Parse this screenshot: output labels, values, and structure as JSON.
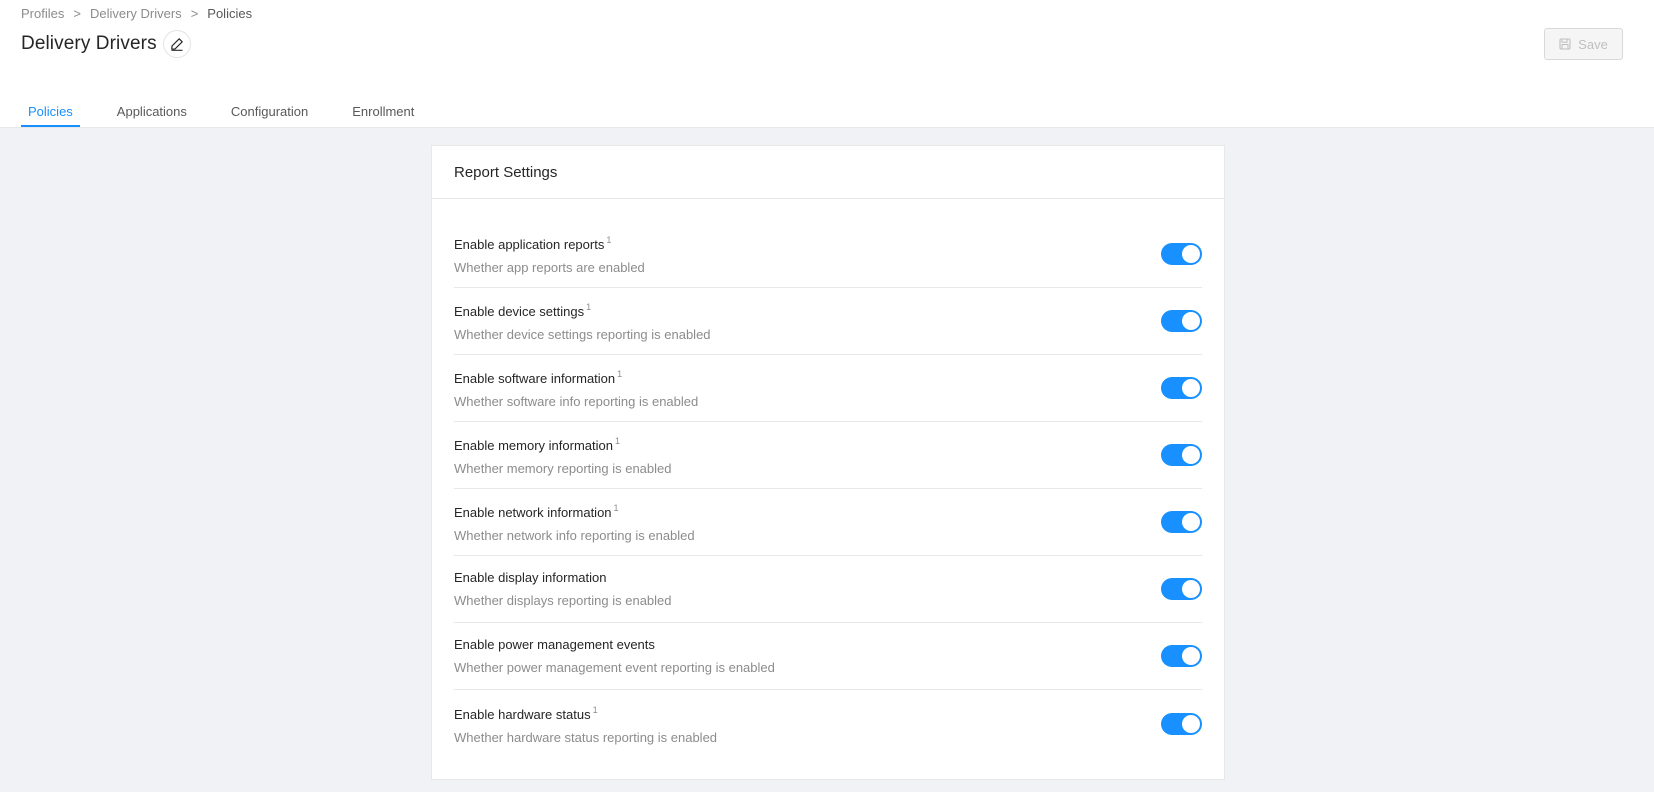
{
  "breadcrumb": {
    "items": [
      "Profiles",
      "Delivery Drivers",
      "Policies"
    ],
    "separator": ">"
  },
  "header": {
    "title": "Delivery Drivers",
    "save_label": "Save"
  },
  "tabs": [
    {
      "label": "Policies",
      "active": true
    },
    {
      "label": "Applications",
      "active": false
    },
    {
      "label": "Configuration",
      "active": false
    },
    {
      "label": "Enrollment",
      "active": false
    }
  ],
  "card": {
    "title": "Report Settings",
    "settings": [
      {
        "title": "Enable application reports",
        "footnote": "1",
        "desc": "Whether app reports are enabled",
        "enabled": true
      },
      {
        "title": "Enable device settings",
        "footnote": "1",
        "desc": "Whether device settings reporting is enabled",
        "enabled": true
      },
      {
        "title": "Enable software information",
        "footnote": "1",
        "desc": "Whether software info reporting is enabled",
        "enabled": true
      },
      {
        "title": "Enable memory information",
        "footnote": "1",
        "desc": "Whether memory reporting is enabled",
        "enabled": true
      },
      {
        "title": "Enable network information",
        "footnote": "1",
        "desc": "Whether network info reporting is enabled",
        "enabled": true
      },
      {
        "title": "Enable display information",
        "footnote": "",
        "desc": "Whether displays reporting is enabled",
        "enabled": true
      },
      {
        "title": "Enable power management events",
        "footnote": "",
        "desc": "Whether power management event reporting is enabled",
        "enabled": true
      },
      {
        "title": "Enable hardware status",
        "footnote": "1",
        "desc": "Whether hardware status reporting is enabled",
        "enabled": true
      }
    ]
  },
  "colors": {
    "accent": "#1890ff",
    "background": "#f0f2f5",
    "text_secondary": "#8c8c8c"
  },
  "icons": {
    "edit": "pencil-icon",
    "save": "floppy-disk-icon"
  }
}
